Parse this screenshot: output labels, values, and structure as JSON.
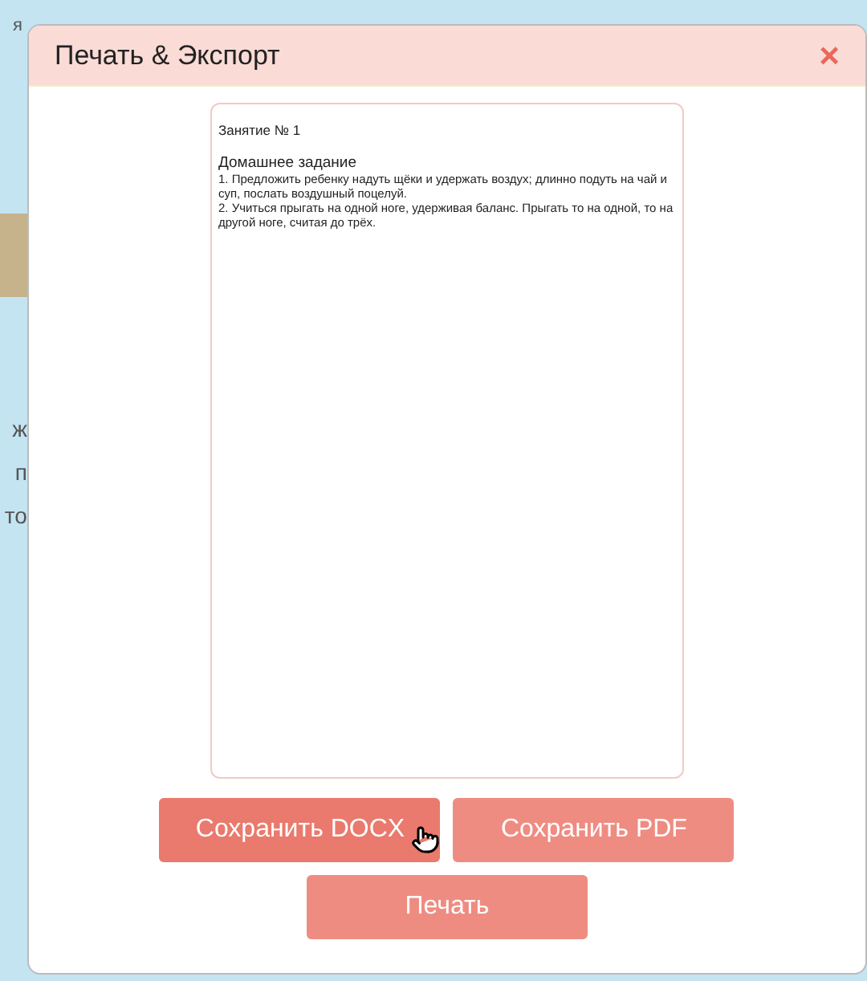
{
  "background": {
    "fragments": [
      "я",
      "ж",
      "п",
      "то"
    ]
  },
  "dialog": {
    "title": "Печать & Экспорт",
    "close": "×",
    "preview": {
      "heading": "Занятие № 1",
      "section": "Домашнее задание",
      "lines": [
        "1. Предложить ребенку надуть щёки и удержать воздух; длинно подуть на чай и суп, послать воздушный поцелуй.",
        "2. Учиться прыгать на одной ноге, удерживая баланс. Прыгать то на одной, то на другой ноге, считая до трёх."
      ]
    },
    "buttons": [
      {
        "label": "Сохранить DOCX",
        "hovered": true
      },
      {
        "label": "Сохранить PDF",
        "hovered": false
      },
      {
        "label": "Печать",
        "hovered": false
      }
    ]
  }
}
